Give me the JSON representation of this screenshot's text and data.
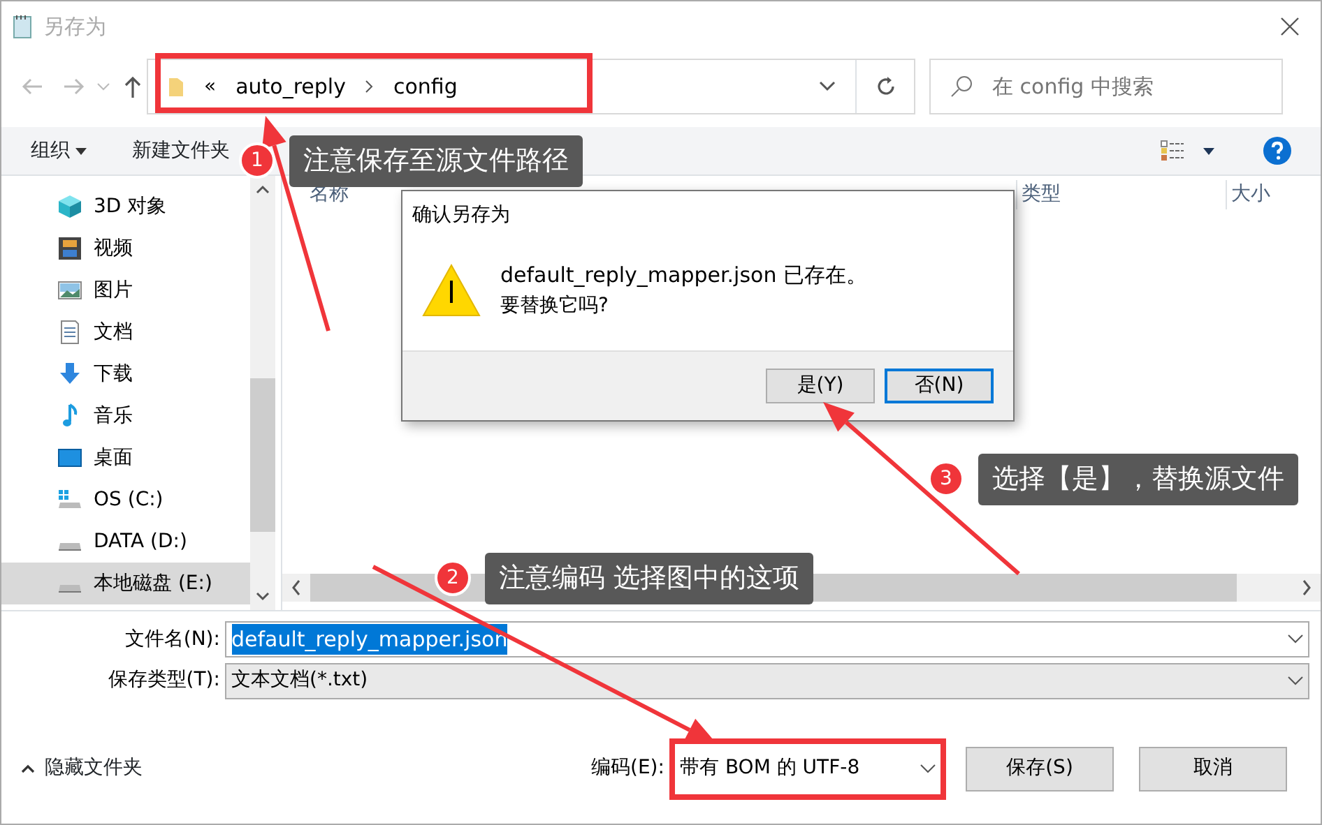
{
  "window": {
    "title": "另存为"
  },
  "address": {
    "overflow": "«",
    "segments": [
      "auto_reply",
      "config"
    ]
  },
  "search": {
    "placeholder": "在 config 中搜索"
  },
  "toolbar": {
    "organize": "组织",
    "new_folder": "新建文件夹"
  },
  "nav_items": [
    {
      "label": "3D 对象",
      "kind": "cube",
      "selected": false
    },
    {
      "label": "视频",
      "kind": "video",
      "selected": false
    },
    {
      "label": "图片",
      "kind": "picture",
      "selected": false
    },
    {
      "label": "文档",
      "kind": "document",
      "selected": false
    },
    {
      "label": "下载",
      "kind": "download",
      "selected": false
    },
    {
      "label": "音乐",
      "kind": "music",
      "selected": false
    },
    {
      "label": "桌面",
      "kind": "desktop",
      "selected": false
    },
    {
      "label": "OS (C:)",
      "kind": "system-drive",
      "selected": false
    },
    {
      "label": "DATA (D:)",
      "kind": "drive",
      "selected": false
    },
    {
      "label": "本地磁盘 (E:)",
      "kind": "drive",
      "selected": true
    }
  ],
  "columns": [
    "名称",
    "类型",
    "大小"
  ],
  "form": {
    "filename_label": "文件名(N):",
    "filename": "default_reply_mapper.json",
    "filetype_label": "保存类型(T):",
    "filetype": "文本文档(*.txt)",
    "hide_folders": "隐藏文件夹",
    "encoding_label": "编码(E):",
    "encoding": "带有 BOM 的 UTF-8",
    "buttons": [
      "保存(S)",
      "取消"
    ]
  },
  "confirm": {
    "title": "确认另存为",
    "message": "default_reply_mapper.json 已存在。",
    "question": "要替换它吗?",
    "buttons": [
      {
        "label": "是(Y)",
        "focused": false
      },
      {
        "label": "否(N)",
        "focused": true
      }
    ]
  },
  "callouts": [
    {
      "number": "1",
      "text": "注意保存至源文件路径"
    },
    {
      "number": "2",
      "text": "注意编码 选择图中的这项"
    },
    {
      "number": "3",
      "text": "选择【是】，替换源文件"
    }
  ]
}
